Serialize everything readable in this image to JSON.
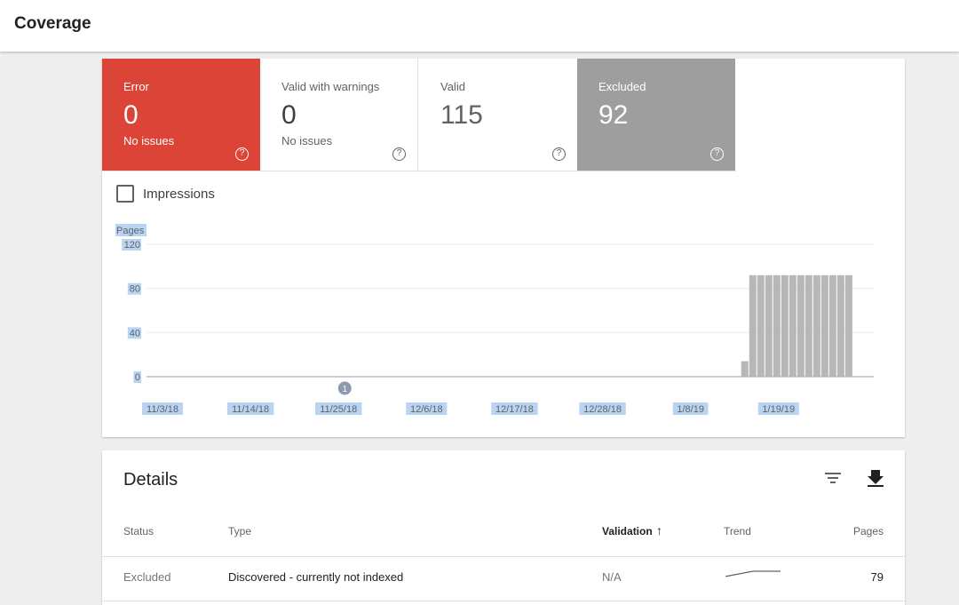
{
  "app": {
    "title": "Coverage"
  },
  "tiles": [
    {
      "id": "error",
      "label": "Error",
      "value": "0",
      "sub": "No issues",
      "color": "#db4437"
    },
    {
      "id": "warnings",
      "label": "Valid with warnings",
      "value": "0",
      "sub": "No issues"
    },
    {
      "id": "valid",
      "label": "Valid",
      "value": "115",
      "sub": ""
    },
    {
      "id": "excluded",
      "label": "Excluded",
      "value": "92",
      "sub": "",
      "color": "#9e9e9e"
    }
  ],
  "help_glyph": "?",
  "impressions": {
    "label": "Impressions",
    "checked": false
  },
  "chart_data": {
    "type": "bar",
    "ylabel": "Pages",
    "ylim": [
      0,
      120
    ],
    "yticks": [
      "120",
      "80",
      "40",
      "0"
    ],
    "x_tick_labels": [
      "11/3/18",
      "11/14/18",
      "11/25/18",
      "12/6/18",
      "12/17/18",
      "12/28/18",
      "1/8/19",
      "1/19/19"
    ],
    "annotation": {
      "label": "1",
      "date": "11/28/18"
    },
    "series": [
      {
        "name": "Excluded",
        "color": "#b7b7b7",
        "dates": [
          "1/17/19",
          "1/18/19",
          "1/19/19",
          "1/20/19",
          "1/21/19",
          "1/22/19",
          "1/23/19",
          "1/24/19",
          "1/25/19",
          "1/26/19",
          "1/27/19",
          "1/28/19",
          "1/29/19",
          "1/30/19"
        ],
        "values": [
          14,
          92,
          92,
          92,
          92,
          92,
          92,
          92,
          92,
          92,
          92,
          92,
          92,
          92
        ]
      }
    ],
    "grid": true
  },
  "details": {
    "title": "Details",
    "columns": {
      "status": "Status",
      "type": "Type",
      "validation": "Validation",
      "validation_sort": "↑",
      "trend": "Trend",
      "pages": "Pages"
    },
    "rows": [
      {
        "status": "Excluded",
        "type": "Discovered - currently not indexed",
        "validation": "N/A",
        "pages": "79",
        "trend": [
          40,
          79,
          79
        ]
      }
    ]
  }
}
